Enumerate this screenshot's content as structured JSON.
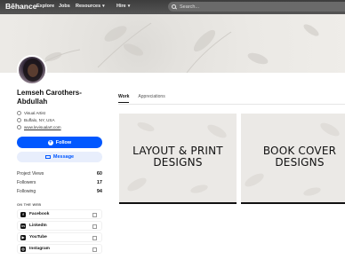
{
  "header": {
    "logo": "Bēhance",
    "nav": [
      {
        "label": "Explore"
      },
      {
        "label": "Jobs"
      },
      {
        "label": "Resources",
        "chevron": "▾"
      },
      {
        "label": "Hire",
        "chevron": "▾"
      }
    ],
    "search": {
      "placeholder": "Search..."
    }
  },
  "profile": {
    "name": "Lemseh Carothers-Abdullah",
    "occupation": "Visual Artist",
    "location": "Buffalo, NY, USA",
    "website": "www.levisualart.com"
  },
  "actions": {
    "follow": "Follow",
    "message": "Message"
  },
  "stats": [
    {
      "label": "Project Views",
      "value": "60"
    },
    {
      "label": "Followers",
      "value": "17"
    },
    {
      "label": "Following",
      "value": "94"
    }
  ],
  "web": {
    "title": "ON THE WEB",
    "links": [
      {
        "label": "Facebook",
        "icon": "facebook-icon",
        "glyph": "f"
      },
      {
        "label": "LinkedIn",
        "icon": "linkedin-icon",
        "glyph": "in"
      },
      {
        "label": "YouTube",
        "icon": "youtube-icon",
        "glyph": "▶"
      },
      {
        "label": "Instagram",
        "icon": "instagram-icon",
        "glyph": "◎"
      }
    ]
  },
  "tabs": [
    {
      "label": "Work"
    },
    {
      "label": "Appreciations"
    }
  ],
  "projects": [
    {
      "title": "LAYOUT & PRINT DESIGNS"
    },
    {
      "title": "BOOK COVER DESIGNS"
    }
  ],
  "colors": {
    "accent": "#0057ff",
    "topbar": "#4a4a4a"
  }
}
